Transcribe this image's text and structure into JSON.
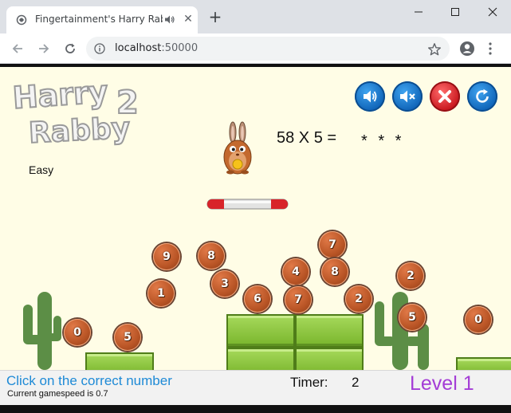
{
  "browser": {
    "tab_title": "Fingertainment's Harry Rabb",
    "url_host": "localhost",
    "url_port": ":50000",
    "icons": [
      "favicon-icon",
      "audio-playing-icon",
      "close-icon",
      "new-tab-icon",
      "minimize-icon",
      "maximize-icon",
      "window-close-icon",
      "back-icon",
      "forward-icon",
      "reload-icon",
      "info-icon",
      "star-icon",
      "profile-icon",
      "menu-icon"
    ]
  },
  "game": {
    "logo_line1": "Harry",
    "logo_line2": "Rabby",
    "logo_number": "2",
    "difficulty": "Easy",
    "equation": "58 X 5 =",
    "answer": "* * *",
    "controls": [
      "sound-on-icon",
      "mute-icon",
      "quit-icon",
      "restart-icon"
    ],
    "balls": [
      {
        "digit": "9"
      },
      {
        "digit": "8"
      },
      {
        "digit": "7"
      },
      {
        "digit": "4"
      },
      {
        "digit": "8"
      },
      {
        "digit": "2"
      },
      {
        "digit": "1"
      },
      {
        "digit": "3"
      },
      {
        "digit": "6"
      },
      {
        "digit": "7"
      },
      {
        "digit": "2"
      },
      {
        "digit": "0"
      },
      {
        "digit": "5"
      },
      {
        "digit": "5"
      },
      {
        "digit": "0"
      }
    ],
    "colors": {
      "background": "#fffde6",
      "ball": "#b85425",
      "block": "#8cc63f",
      "level": "#a43dd6",
      "instruction": "#1e8ad6"
    }
  },
  "status": {
    "instruction": "Click on the correct number",
    "speed_text": "Current gamespeed is 0.7",
    "timer_label": "Timer:",
    "timer_value": "2",
    "level": "Level 1"
  }
}
